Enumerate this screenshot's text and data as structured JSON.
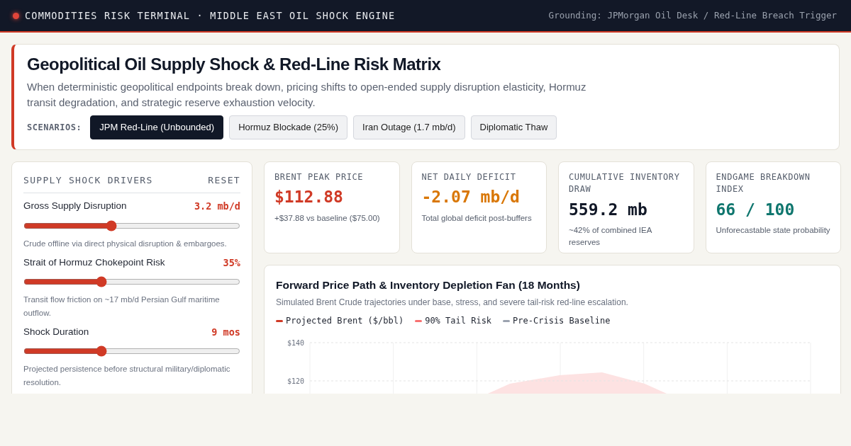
{
  "topbar": {
    "title": "COMMODITIES RISK TERMINAL · MIDDLE EAST OIL SHOCK ENGINE",
    "grounding": "Grounding: JPMorgan Oil Desk / Red-Line Breach Trigger"
  },
  "header": {
    "title": "Geopolitical Oil Supply Shock & Red-Line Risk Matrix",
    "description": "When deterministic geopolitical endpoints break down, pricing shifts to open-ended supply disruption elasticity, Hormuz transit degradation, and strategic reserve exhaustion velocity.",
    "scenarios_label": "SCENARIOS:",
    "scenarios": [
      {
        "label": "JPM Red-Line (Unbounded)",
        "selected": true
      },
      {
        "label": "Hormuz Blockade (25%)",
        "selected": false
      },
      {
        "label": "Iran Outage (1.7 mb/d)",
        "selected": false
      },
      {
        "label": "Diplomatic Thaw",
        "selected": false
      }
    ]
  },
  "drivers": {
    "title": "SUPPLY SHOCK DRIVERS",
    "reset": "RESET",
    "sliders": [
      {
        "label": "Gross Supply Disruption",
        "reading": "3.2 mb/d",
        "level": 0.4,
        "note": "Crude offline via direct physical disruption & embargoes."
      },
      {
        "label": "Strait of Hormuz Chokepoint Risk",
        "reading": "35%",
        "level": 0.35,
        "note": "Transit flow friction on ~17 mb/d Persian Gulf maritime outflow."
      },
      {
        "label": "Shock Duration",
        "reading": "9 mos",
        "level": 0.35,
        "note": "Projected persistence before structural military/diplomatic resolution."
      }
    ]
  },
  "kpis": [
    {
      "label": "BRENT PEAK PRICE",
      "value": "$112.88",
      "color": "#d03a26",
      "note": "+$37.88 vs baseline ($75.00)"
    },
    {
      "label": "NET DAILY DEFICIT",
      "value": "-2.07 mb/d",
      "color": "#d97706",
      "note": "Total global deficit post-buffers"
    },
    {
      "label": "CUMULATIVE INVENTORY DRAW",
      "value": "559.2 mb",
      "color": "#111827",
      "note": "~42% of combined IEA reserves"
    },
    {
      "label": "ENDGAME BREAKDOWN INDEX",
      "value": "66 / 100",
      "color": "#0f766e",
      "note": "Unforecastable state probability"
    }
  ],
  "chart_panel": {
    "title": "Forward Price Path & Inventory Depletion Fan (18 Months)",
    "subtitle": "Simulated Brent Crude trajectories under base, stress, and severe tail-risk red-line escalation.",
    "legend": [
      {
        "label": "Projected Brent ($/bbl)",
        "color": "#d03a26"
      },
      {
        "label": "90% Tail Risk",
        "color": "#f87171"
      },
      {
        "label": "Pre-Crisis Baseline",
        "color": "#9ca3af"
      }
    ],
    "y_axis_labels": [
      "$140",
      "$120"
    ]
  }
}
